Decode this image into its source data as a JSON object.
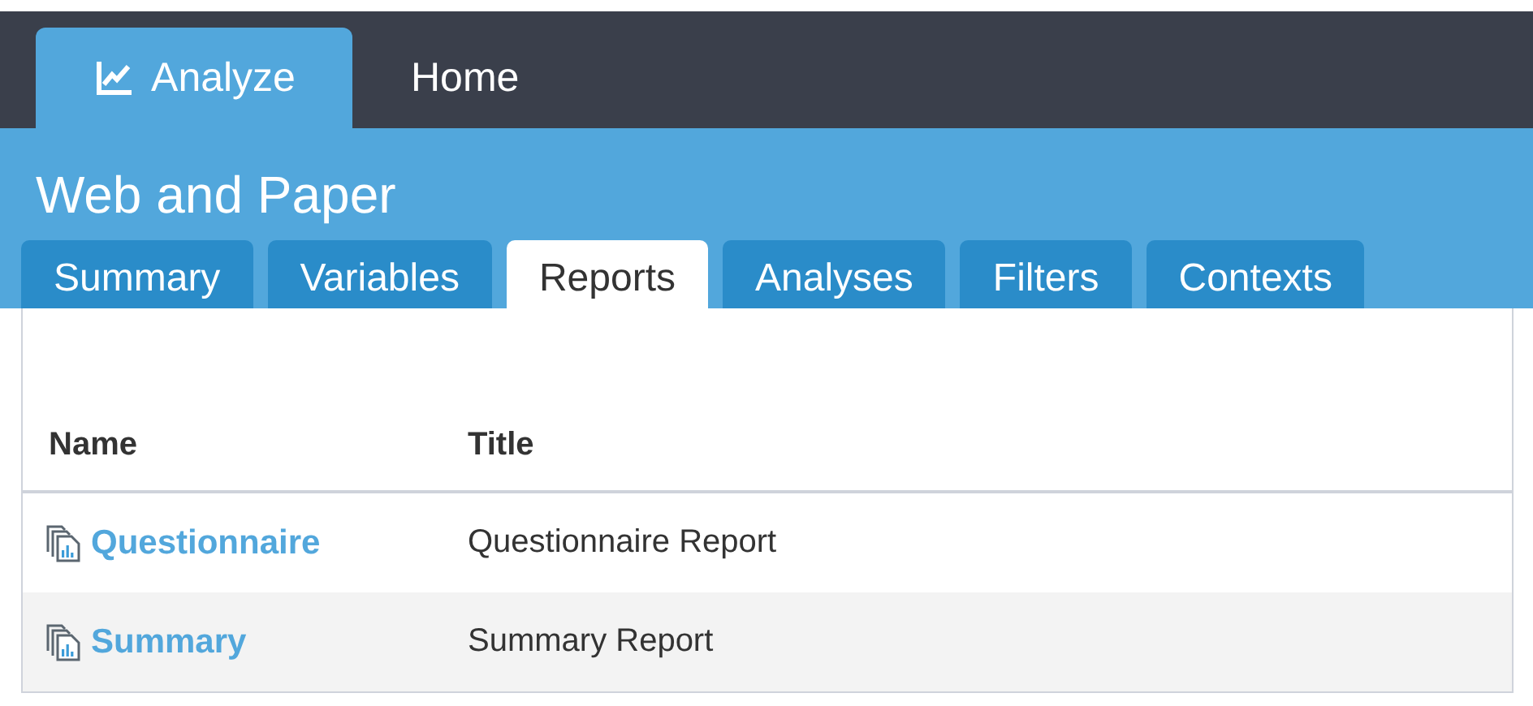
{
  "top_tabs": [
    {
      "label": "Analyze",
      "kind": "icon-tab",
      "selected": true
    },
    {
      "label": "Home",
      "kind": "text-tab",
      "selected": false
    }
  ],
  "project_title": "Web and Paper",
  "tabs": [
    {
      "label": "Summary",
      "selected": false
    },
    {
      "label": "Variables",
      "selected": false
    },
    {
      "label": "Reports",
      "selected": true
    },
    {
      "label": "Analyses",
      "selected": false
    },
    {
      "label": "Filters",
      "selected": false
    },
    {
      "label": "Contexts",
      "selected": false
    }
  ],
  "table": {
    "columns": [
      "Name",
      "Title"
    ],
    "rows": [
      {
        "name": "Questionnaire",
        "title": "Questionnaire Report"
      },
      {
        "name": "Summary",
        "title": "Summary Report"
      }
    ]
  }
}
